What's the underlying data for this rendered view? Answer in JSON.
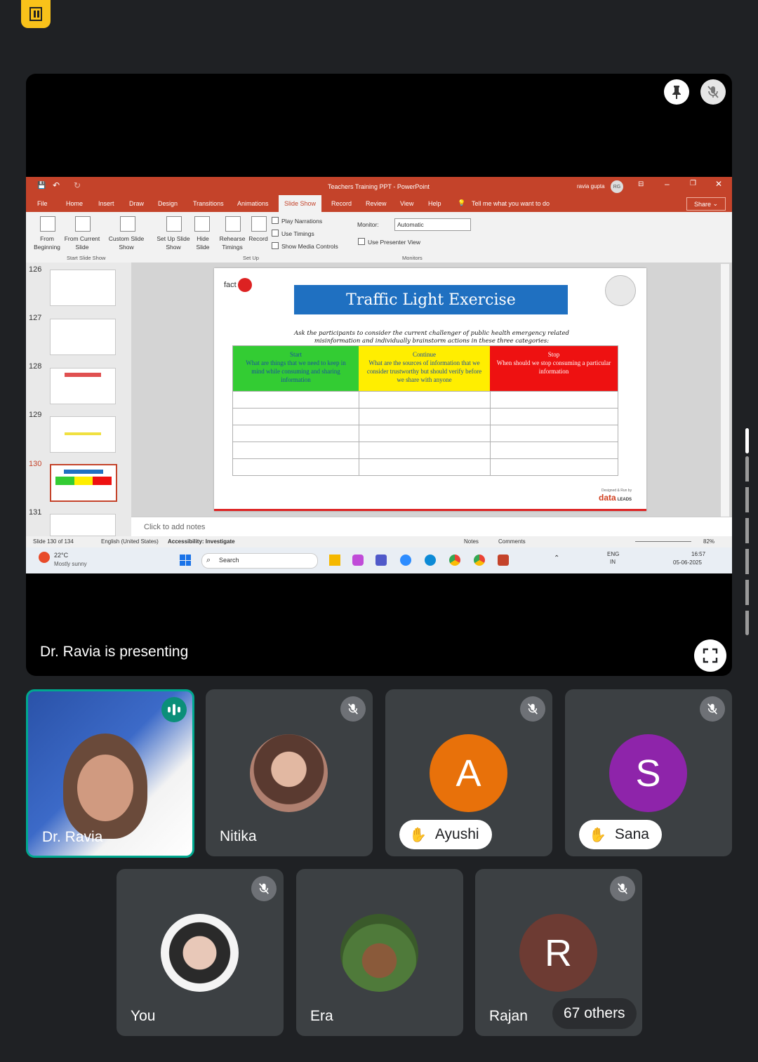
{
  "stage": {
    "presenting_label": "Dr. Ravia is presenting"
  },
  "ppt": {
    "window_title": "Teachers Training PPT  -  PowerPoint",
    "user_name": "ravia gupta",
    "user_initials": "RG",
    "share_label": "Share",
    "tabs": [
      "File",
      "Home",
      "Insert",
      "Draw",
      "Design",
      "Transitions",
      "Animations",
      "Slide Show",
      "Record",
      "Review",
      "View",
      "Help"
    ],
    "active_tab": "Slide Show",
    "tell_me": "Tell me what you want to do",
    "ribbon": {
      "from_beginning": "From Beginning",
      "from_current": "From Current Slide",
      "custom_show": "Custom Slide Show",
      "start_group": "Start Slide Show",
      "set_up_show": "Set Up Slide Show",
      "hide_slide": "Hide Slide",
      "rehearse": "Rehearse Timings",
      "record": "Record",
      "play_narrations": "Play Narrations",
      "use_timings": "Use Timings",
      "show_media": "Show Media Controls",
      "setup_group": "Set Up",
      "monitor_label": "Monitor:",
      "monitor_value": "Automatic",
      "presenter_view": "Use Presenter View",
      "monitors_group": "Monitors"
    },
    "thumb_numbers": [
      "126",
      "127",
      "128",
      "129",
      "130",
      "131"
    ],
    "slide": {
      "title": "Traffic Light Exercise",
      "intro": "Ask the participants to consider the current challenger of public health emergency related misinformation and individually brainstorm actions in these three categories:",
      "start_head": "Start",
      "start_text": "What are things that we need to keep in mind while consuming and sharing information",
      "continue_head": "Continue",
      "continue_text": "What are the sources of information that we consider trustworthy but should verify before we share with anyone",
      "stop_head": "Stop",
      "stop_text": "When should we stop consuming a particular information",
      "logo_text": "fact",
      "datalead": "data",
      "datalead_sub": "LEADS",
      "designed_by": "Designed & Run by"
    },
    "notes_placeholder": "Click to add notes",
    "status": {
      "slide_count": "Slide 130 of 134",
      "language": "English (United States)",
      "accessibility": "Accessibility: Investigate",
      "notes": "Notes",
      "comments": "Comments",
      "zoom": "82%"
    },
    "taskbar": {
      "temp": "22°C",
      "weather": "Mostly sunny",
      "search": "Search",
      "lang_top": "ENG",
      "lang_bottom": "IN",
      "time": "16:57",
      "date": "05-06-2025"
    }
  },
  "participants": {
    "ravia": "Dr. Ravia",
    "nitika": "Nitika",
    "ayushi": "Ayushi",
    "ayushi_initial": "A",
    "sana": "Sana",
    "sana_initial": "S",
    "you": "You",
    "era": "Era",
    "rajan": "Rajan",
    "rajan_initial": "R",
    "others": "67 others"
  },
  "colors": {
    "ppt_accent": "#c4432a",
    "ayushi": "#e8710a",
    "sana": "#8e24aa",
    "rajan": "#6d3b33",
    "start_green": "#33cc33",
    "continue_yellow": "#ffee00",
    "stop_red": "#ee1111"
  }
}
